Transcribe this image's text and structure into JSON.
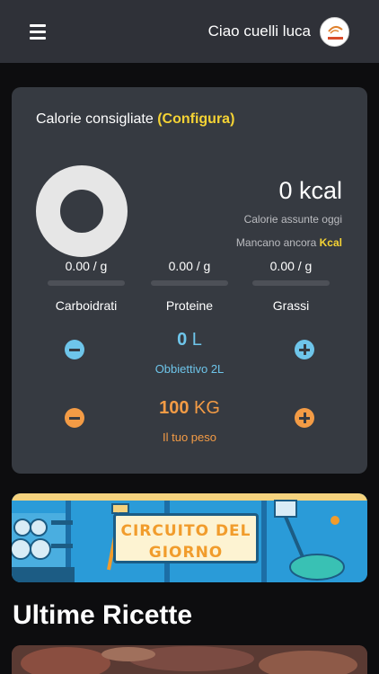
{
  "header": {
    "menu_icon": "hamburger-menu-icon",
    "greeting": "Ciao cuelli luca",
    "avatar_icon": "user-avatar"
  },
  "calories_card": {
    "title": "Calorie consigliate",
    "configure_label": "(Configura)",
    "kcal_value": "0 kcal",
    "kcal_caption": "Calorie assunte oggi",
    "remaining_label": "Mancano ancora",
    "remaining_unit": "Kcal",
    "ring_progress": 0,
    "macros": [
      {
        "value": "0.00 / g",
        "label": "Carboidrati"
      },
      {
        "value": "0.00 / g",
        "label": "Proteine"
      },
      {
        "value": "0.00 / g",
        "label": "Grassi"
      }
    ]
  },
  "water": {
    "amount": "0",
    "unit": "L",
    "goal_label": "Obbiettivo 2L",
    "color": "#6ec5ea"
  },
  "weight": {
    "amount": "100",
    "unit": "KG",
    "label": "Il tuo peso",
    "color": "#f39b45"
  },
  "banner": {
    "line1": "CIRCUITO DEL",
    "line2": "GIORNO"
  },
  "recipes": {
    "title": "Ultime Ricette"
  },
  "colors": {
    "accent_yellow": "#f5d334",
    "card_bg": "#363a41",
    "header_bg": "#2f3138"
  }
}
